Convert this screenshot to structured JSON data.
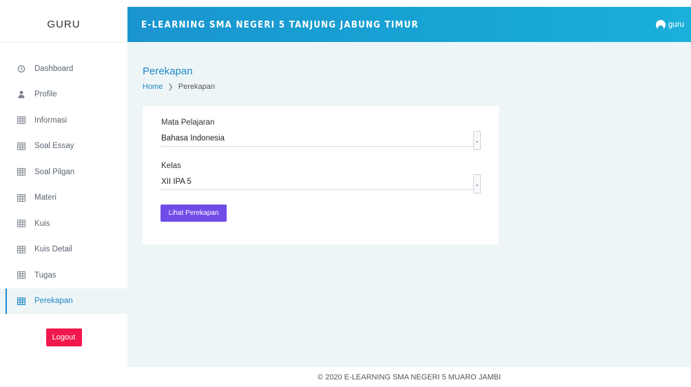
{
  "brand": "GURU",
  "header": {
    "title": "E-LEARNING SMA NEGERI 5 TANJUNG JABUNG TIMUR",
    "user": "guru"
  },
  "sidebar": {
    "items": [
      {
        "label": "Dashboard",
        "icon": "clock-icon"
      },
      {
        "label": "Profile",
        "icon": "user-icon"
      },
      {
        "label": "Informasi",
        "icon": "table-icon"
      },
      {
        "label": "Soal Essay",
        "icon": "table-icon"
      },
      {
        "label": "Soal Pilgan",
        "icon": "table-icon"
      },
      {
        "label": "Materi",
        "icon": "table-icon"
      },
      {
        "label": "Kuis",
        "icon": "table-icon"
      },
      {
        "label": "Kuis Detail",
        "icon": "table-icon"
      },
      {
        "label": "Tugas",
        "icon": "table-icon"
      },
      {
        "label": "Perekapan",
        "icon": "table-icon",
        "active": true
      }
    ],
    "logout": "Logout"
  },
  "main": {
    "title": "Perekapan",
    "breadcrumb": {
      "home": "Home",
      "current": "Perekapan"
    },
    "form": {
      "subject_label": "Mata Pelajaran",
      "subject_value": "Bahasa Indonesia",
      "class_label": "Kelas",
      "class_value": "XII IPA 5",
      "submit": "Lihat Perekapan"
    }
  },
  "footer": "© 2020 E-LEARNING SMA NEGERI 5 MUARO JAMBI",
  "colors": {
    "accent": "#1e88c7",
    "header_gradient_start": "#1a94cf",
    "button_primary": "#6f4ce8",
    "button_danger": "#f0184d",
    "background": "#eef5f7"
  }
}
